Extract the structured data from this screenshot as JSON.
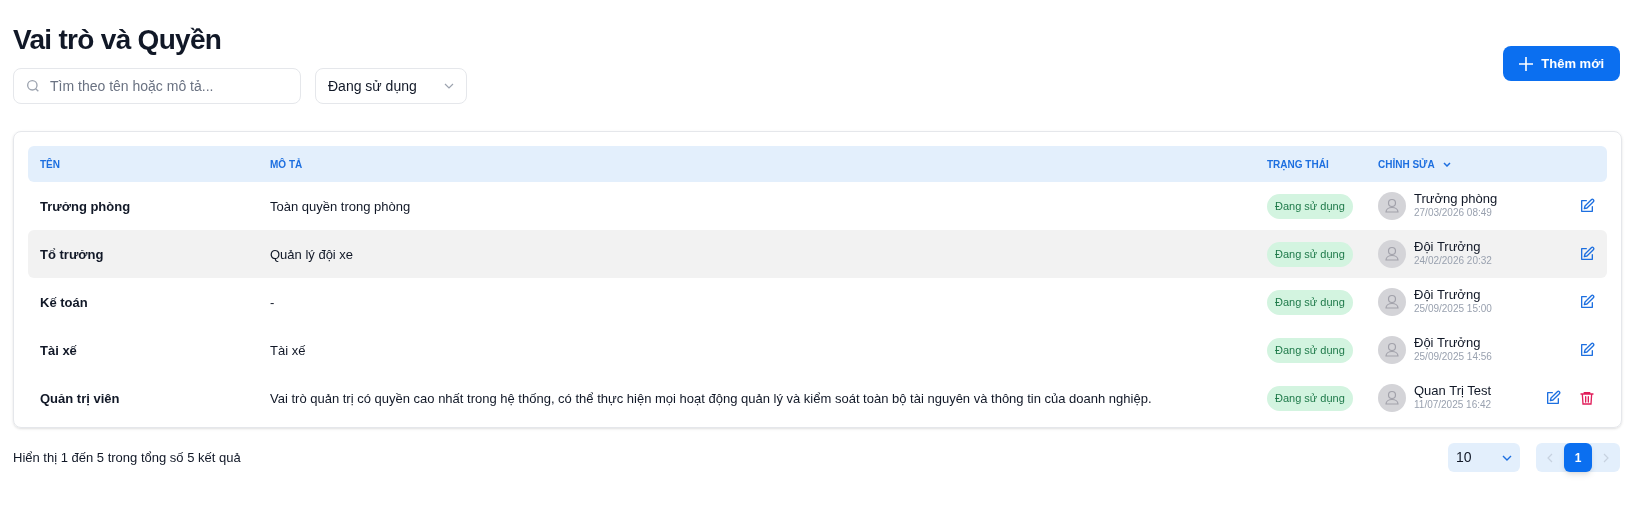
{
  "title": "Vai trò và Quyền",
  "search": {
    "placeholder": "Tìm theo tên hoặc mô tả..."
  },
  "status_filter": {
    "value": "Đang sử dụng"
  },
  "add_button": {
    "label": "Thêm mới"
  },
  "table": {
    "columns": [
      {
        "label": "TÊN",
        "sortable": false
      },
      {
        "label": "MÔ TẢ",
        "sortable": false
      },
      {
        "label": "TRẠNG THÁI",
        "sortable": false
      },
      {
        "label": "CHỈNH SỬA",
        "sortable": true
      }
    ],
    "rows": [
      {
        "name": "Trưởng phòng",
        "description": "Toàn quyền trong phòng",
        "status": "Đang sử dụng",
        "editor": "Trưởng phòng",
        "edited_at": "27/03/2026 08:49",
        "hovered": false,
        "deletable": false
      },
      {
        "name": "Tổ trưởng",
        "description": "Quản lý đội xe",
        "status": "Đang sử dụng",
        "editor": "Đội Trưởng",
        "edited_at": "24/02/2026 20:32",
        "hovered": true,
        "deletable": false
      },
      {
        "name": "Kế toán",
        "description": "-",
        "status": "Đang sử dụng",
        "editor": "Đội Trưởng",
        "edited_at": "25/09/2025 15:00",
        "hovered": false,
        "deletable": false
      },
      {
        "name": "Tài xế",
        "description": "Tài xế",
        "status": "Đang sử dụng",
        "editor": "Đội Trưởng",
        "edited_at": "25/09/2025 14:56",
        "hovered": false,
        "deletable": false
      },
      {
        "name": "Quản trị viên",
        "description": "Vai trò quản trị có quyền cao nhất trong hệ thống, có thể thực hiện mọi hoạt động quản lý và kiểm soát toàn bộ tài nguyên và thông tin của doanh nghiệp.",
        "status": "Đang sử dụng",
        "editor": "Quan Trị Test",
        "edited_at": "11/07/2025 16:42",
        "hovered": false,
        "deletable": true
      }
    ]
  },
  "summary": "Hiển thị 1 đến 5 trong tổng số 5 kết quả",
  "page_size": {
    "value": "10"
  },
  "pagination": {
    "prev_disabled": true,
    "next_disabled": true,
    "pages": [
      {
        "label": "1",
        "selected": true
      }
    ]
  }
}
